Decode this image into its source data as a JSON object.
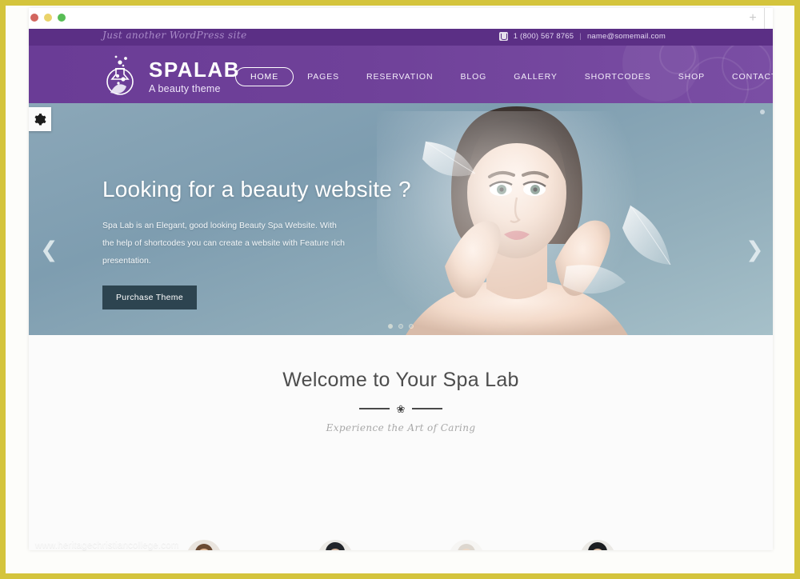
{
  "browser": {
    "window_controls": [
      "close",
      "minimize",
      "maximize"
    ],
    "new_tab_label": "+"
  },
  "site": {
    "topbar": {
      "tagline": "Just another WordPress site",
      "phone_icon": "phone-icon",
      "phone": "1 (800) 567 8765",
      "separator": "|",
      "email": "name@somemail.com"
    },
    "brand": {
      "logo_icon": "flask-logo-icon",
      "name": "SPALAB",
      "subtitle": "A beauty theme"
    },
    "nav": {
      "items": [
        {
          "label": "HOME",
          "active": true
        },
        {
          "label": "PAGES",
          "active": false
        },
        {
          "label": "RESERVATION",
          "active": false
        },
        {
          "label": "BLOG",
          "active": false
        },
        {
          "label": "GALLERY",
          "active": false
        },
        {
          "label": "SHORTCODES",
          "active": false
        },
        {
          "label": "SHOP",
          "active": false
        },
        {
          "label": "CONTACT",
          "active": false
        }
      ]
    },
    "hero": {
      "settings_icon": "gear-icon",
      "title": "Looking for a beauty website ?",
      "description": "Spa Lab is an Elegant, good looking Beauty Spa Website. With the help of shortcodes you can create a website with Feature rich presentation.",
      "cta_label": "Purchase Theme",
      "prev_icon": "chevron-left-icon",
      "next_icon": "chevron-right-icon",
      "slide_count": 3,
      "active_slide": 1
    },
    "welcome": {
      "title": "Welcome to Your Spa Lab",
      "divider_icon": "flower-divider-icon",
      "subtitle": "Experience the Art of Caring",
      "avatar_count": 4
    }
  },
  "watermark": "www.heritagechristiancollege.com",
  "colors": {
    "frame_gold": "#d4c43c",
    "purple_header": "#6f4199",
    "purple_topbar": "#5b2f85",
    "hero_blue": "#8ba7b8",
    "cta_dark": "#2d4450",
    "dot_red": "#d2665f",
    "dot_yellow": "#ead36a",
    "dot_green": "#58bd55"
  }
}
